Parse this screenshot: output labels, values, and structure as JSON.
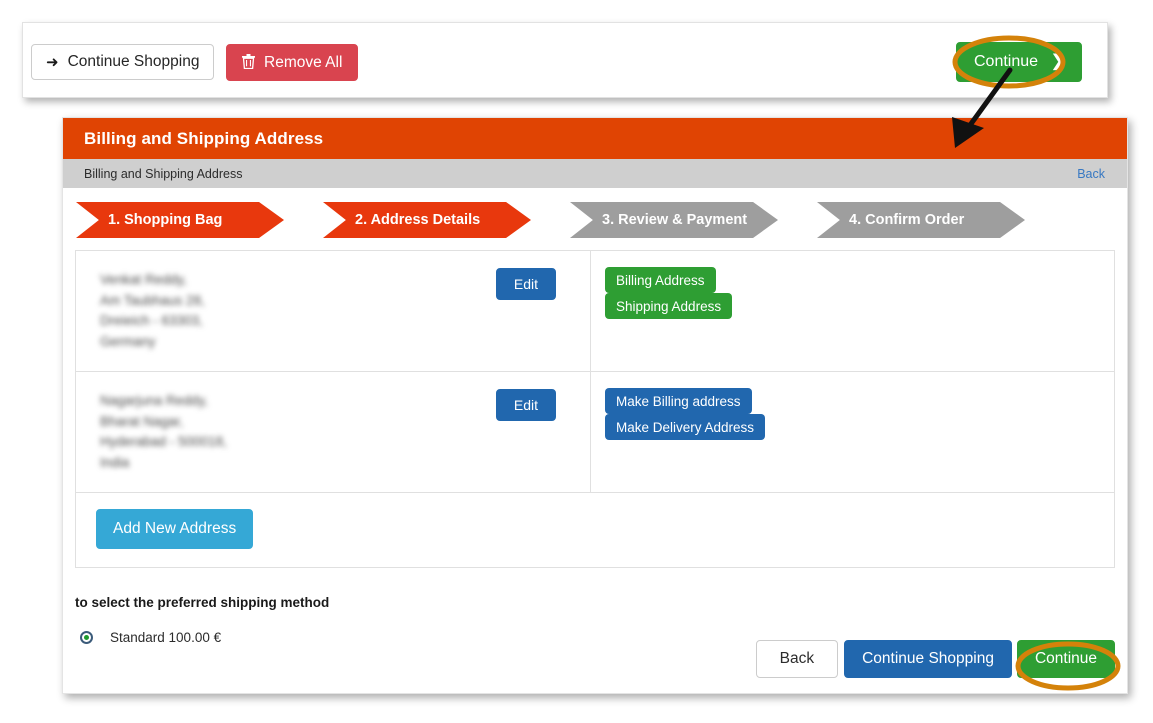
{
  "top_bar": {
    "continue_shopping_label": "Continue Shopping",
    "continue_shopping_icon": "arrow-right-curved-icon",
    "remove_all_label": "Remove All",
    "remove_all_icon": "trash-icon",
    "continue_label": "Continue",
    "continue_icon": "chevron-right-icon"
  },
  "panel": {
    "header_title": "Billing and Shipping Address",
    "subbar_text": "Billing and Shipping Address",
    "back_link": "Back"
  },
  "steps": [
    {
      "label": "1. Shopping Bag",
      "state": "active"
    },
    {
      "label": "2. Address Details",
      "state": "active"
    },
    {
      "label": "3. Review & Payment",
      "state": "inactive"
    },
    {
      "label": "4. Confirm Order",
      "state": "inactive"
    }
  ],
  "addresses": [
    {
      "lines": [
        "Venkat Reddy,",
        "Am Taubhaus 28,",
        "Dreieich - 63303,",
        "Germany"
      ],
      "edit_label": "Edit",
      "actions": [
        {
          "label": "Billing Address",
          "style": "green"
        },
        {
          "label": "Shipping Address",
          "style": "green"
        }
      ]
    },
    {
      "lines": [
        "Nagarjuna Reddy,",
        "Bharat Nagar,",
        "Hyderabad - 500018,",
        "India"
      ],
      "edit_label": "Edit",
      "actions": [
        {
          "label": "Make Billing address",
          "style": "blue"
        },
        {
          "label": "Make Delivery Address",
          "style": "blue"
        }
      ]
    }
  ],
  "add_new_address_label": "Add New Address",
  "shipping": {
    "title": "to select the preferred shipping method",
    "option_label": "Standard 100.00 €",
    "option_selected": true
  },
  "footer": {
    "back_label": "Back",
    "continue_shopping_label": "Continue Shopping",
    "continue_label": "Continue"
  },
  "colors": {
    "orange_header": "#e04403",
    "step_active": "#e8380d",
    "step_inactive": "#9e9e9e",
    "green_button": "#2e9e33",
    "blue_button": "#2167ae",
    "light_blue_button": "#35a8d6",
    "red_button": "#d9444f",
    "annotation_orange": "#d4820a",
    "link_blue": "#3778c2"
  },
  "annotations": {
    "ellipse_top_target": "continue-button-top",
    "ellipse_bottom_target": "continue-button-bottom",
    "arrow_from": "continue-button-top",
    "arrow_to": "panel-header"
  }
}
